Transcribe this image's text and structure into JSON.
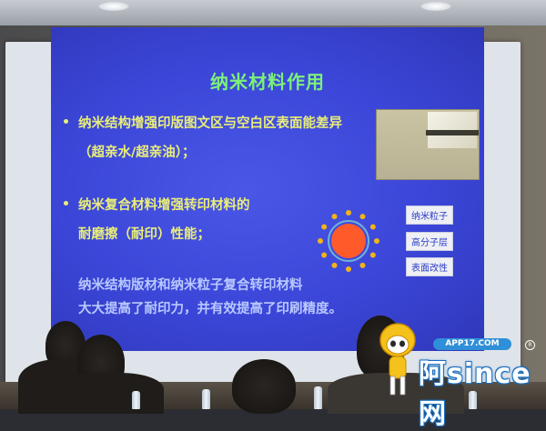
{
  "slide": {
    "title": "纳米材料作用",
    "bullet1_line1": "纳米结构增强印版图文区与空白区表面能差异",
    "bullet1_line2": "（超亲水/超亲油）；",
    "bullet2_line1": "纳米复合材料增强转印材料的",
    "bullet2_line2": "耐磨擦（耐印）性能；",
    "conclusion_line1": "纳米结构版材和纳米粒子复合转印材料",
    "conclusion_line2": "大大提高了耐印力，并有效提高了印刷精度。",
    "diagram_labels": [
      "纳米粒子",
      "高分子层",
      "表面改性"
    ]
  },
  "watermark": {
    "url": "APP17.COM",
    "name": "阿since网",
    "reg": "R"
  },
  "colors": {
    "slide_bg": "#3b46d8",
    "title": "#7cf07a",
    "text": "#e9ee78",
    "particle": "#ff5a2a",
    "dot": "#f2b418"
  }
}
